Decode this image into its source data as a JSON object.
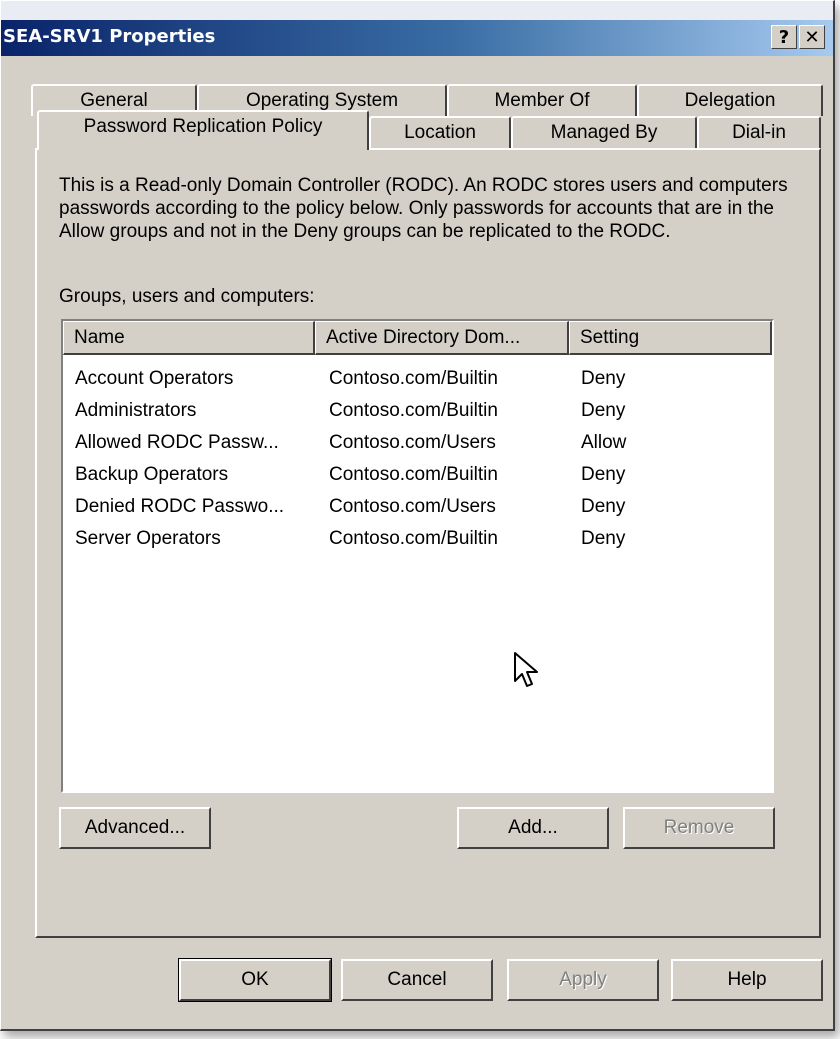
{
  "window": {
    "title": "SEA-SRV1 Properties",
    "help_glyph": "?",
    "close_glyph": "✕"
  },
  "tabs": {
    "row1": [
      "General",
      "Operating System",
      "Member Of",
      "Delegation"
    ],
    "row2": [
      "Password Replication Policy",
      "Location",
      "Managed By",
      "Dial-in"
    ],
    "active": "Password Replication Policy"
  },
  "policy": {
    "description": "This is a Read-only Domain Controller (RODC).  An RODC stores users and computers passwords according to the policy below.  Only passwords for accounts that are in the Allow groups and not in the Deny groups can be replicated to the RODC.",
    "list_label": "Groups, users and computers:",
    "columns": [
      "Name",
      "Active Directory Dom...",
      "Setting"
    ],
    "rows": [
      {
        "name": "Account Operators",
        "domain": "Contoso.com/Builtin",
        "setting": "Deny"
      },
      {
        "name": "Administrators",
        "domain": "Contoso.com/Builtin",
        "setting": "Deny"
      },
      {
        "name": "Allowed RODC Passw...",
        "domain": "Contoso.com/Users",
        "setting": "Allow"
      },
      {
        "name": "Backup Operators",
        "domain": "Contoso.com/Builtin",
        "setting": "Deny"
      },
      {
        "name": "Denied RODC Passwo...",
        "domain": "Contoso.com/Users",
        "setting": "Deny"
      },
      {
        "name": "Server Operators",
        "domain": "Contoso.com/Builtin",
        "setting": "Deny"
      }
    ],
    "advanced_label": "Advanced...",
    "add_label": "Add...",
    "remove_label": "Remove"
  },
  "footer": {
    "ok_label": "OK",
    "cancel_label": "Cancel",
    "apply_label": "Apply",
    "help_label": "Help"
  },
  "icons": {
    "cursor": "arrow-cursor-icon"
  }
}
